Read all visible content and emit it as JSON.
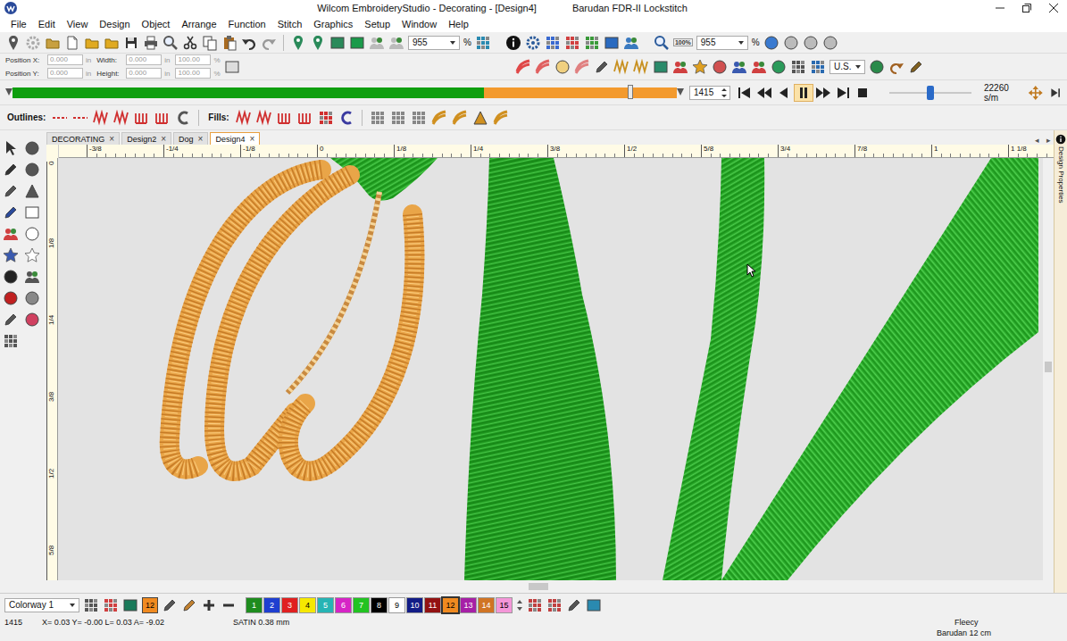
{
  "window": {
    "title": "Wilcom EmbroideryStudio - Decorating - [Design4]",
    "machine": "Barudan FDR-II Lockstitch"
  },
  "menu": [
    "File",
    "Edit",
    "View",
    "Design",
    "Object",
    "Arrange",
    "Function",
    "Stitch",
    "Graphics",
    "Setup",
    "Window",
    "Help"
  ],
  "toolbar": {
    "zoom_fields": [
      {
        "value": "955",
        "unit": "%"
      },
      {
        "value": "955",
        "unit": "%"
      }
    ],
    "zoom_badge": "100%",
    "units": "U.S."
  },
  "transform": {
    "fields": [
      {
        "label": "Position X:",
        "value": "0.000",
        "unit": "in"
      },
      {
        "label": "Position Y:",
        "value": "0.000",
        "unit": "in"
      },
      {
        "label": "Width:",
        "value": "0.000",
        "unit": "in"
      },
      {
        "label": "Height:",
        "value": "0.000",
        "unit": "in"
      }
    ],
    "scales": [
      {
        "value": "100.00",
        "unit": "%"
      },
      {
        "value": "100.00",
        "unit": "%"
      }
    ]
  },
  "player": {
    "level": 0.71,
    "marker": 0.93,
    "stitch": "1415",
    "paused": true,
    "speed": {
      "level": 0.5,
      "reading": "22260 s/m"
    }
  },
  "stitch_types": {
    "outlines_label": "Outlines:",
    "fills_label": "Fills:"
  },
  "tabs": [
    {
      "label": "DECORATING",
      "selected": false,
      "close": "×"
    },
    {
      "label": "Design2",
      "selected": false,
      "close": "×"
    },
    {
      "label": "Dog",
      "selected": false,
      "close": "×"
    },
    {
      "label": "Design4",
      "selected": true,
      "close": "×"
    }
  ],
  "tab_nav": [
    "◂",
    "▸"
  ],
  "rulers": {
    "top": [
      "-3/8",
      "-1/4",
      "-1/8",
      "0",
      "1/8",
      "1/4",
      "3/8",
      "1/2",
      "5/8",
      "3/4",
      "7/8",
      "1",
      "1 1/8"
    ],
    "left": [
      "0",
      "1/8",
      "1/4",
      "3/8",
      "1/2",
      "5/8"
    ]
  },
  "side_panel": {
    "label": "Design Properties"
  },
  "colorway": {
    "name": "Colorway 1",
    "current": {
      "number": "12",
      "color": "#f08a20"
    },
    "swatches": [
      {
        "number": "1",
        "color": "#1e8c1e",
        "selected": false
      },
      {
        "number": "2",
        "color": "#1f3fd0",
        "selected": false
      },
      {
        "number": "3",
        "color": "#e02020",
        "selected": false
      },
      {
        "number": "4",
        "color": "#f6e800",
        "selected": false
      },
      {
        "number": "5",
        "color": "#26b4b4",
        "selected": false
      },
      {
        "number": "6",
        "color": "#d624c6",
        "selected": false
      },
      {
        "number": "7",
        "color": "#22c322",
        "selected": false
      },
      {
        "number": "8",
        "color": "#000000",
        "selected": false
      },
      {
        "number": "9",
        "color": "#ffffff",
        "selected": false
      },
      {
        "number": "10",
        "color": "#121c86",
        "selected": false
      },
      {
        "number": "11",
        "color": "#921212",
        "selected": false
      },
      {
        "number": "12",
        "color": "#f08a20",
        "selected": true
      },
      {
        "number": "13",
        "color": "#a620a6",
        "selected": false
      },
      {
        "number": "14",
        "color": "#d07424",
        "selected": false
      },
      {
        "number": "15",
        "color": "#f496d8",
        "selected": false
      }
    ]
  },
  "status": {
    "stitch": "1415",
    "coords": "X= 0.03 Y= -0.00 L= 0.03 A= -9.02",
    "object": "SATIN 0.38 mm",
    "fabric": "Fleecy",
    "hoop": "Barudan 12 cm"
  }
}
